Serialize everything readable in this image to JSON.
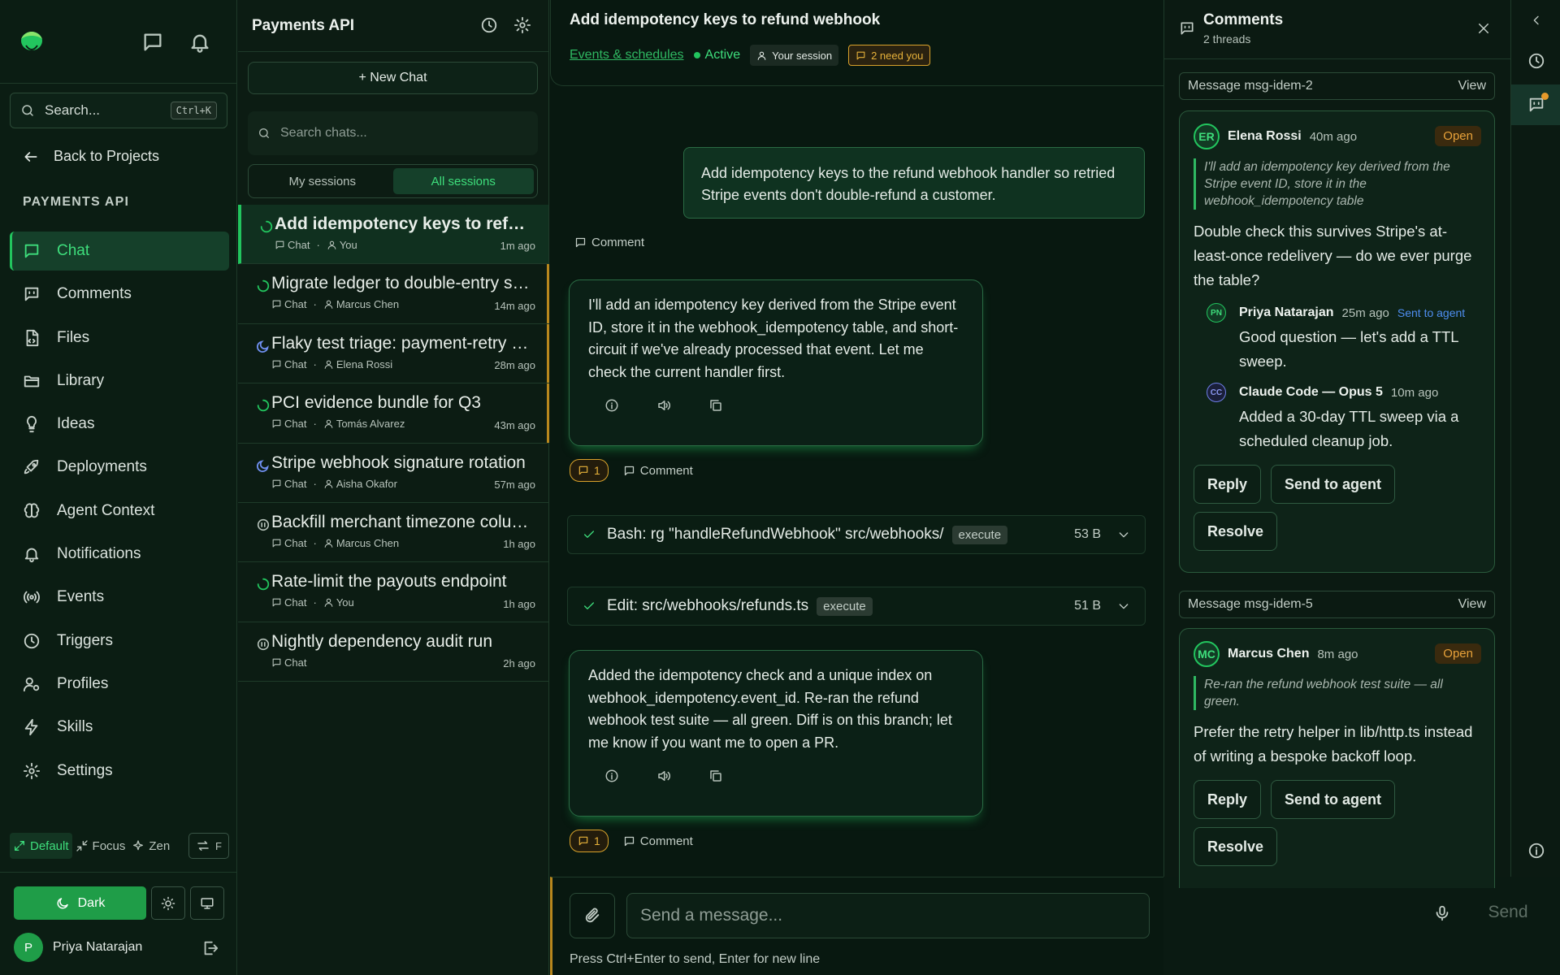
{
  "nav": {
    "search_placeholder": "Search...",
    "search_shortcut": "Ctrl+K",
    "back_label": "Back to Projects",
    "project_heading": "PAYMENTS API",
    "items": [
      {
        "label": "Chat",
        "icon": "chat-icon"
      },
      {
        "label": "Comments",
        "icon": "comments-icon"
      },
      {
        "label": "Files",
        "icon": "file-icon"
      },
      {
        "label": "Library",
        "icon": "folder-icon"
      },
      {
        "label": "Ideas",
        "icon": "lightbulb-icon"
      },
      {
        "label": "Deployments",
        "icon": "rocket-icon"
      },
      {
        "label": "Agent Context",
        "icon": "brain-icon"
      },
      {
        "label": "Notifications",
        "icon": "bell-icon"
      },
      {
        "label": "Events",
        "icon": "broadcast-icon"
      },
      {
        "label": "Triggers",
        "icon": "clock-icon"
      },
      {
        "label": "Profiles",
        "icon": "user-gear-icon"
      },
      {
        "label": "Skills",
        "icon": "lightning-icon"
      },
      {
        "label": "Settings",
        "icon": "gear-icon"
      }
    ],
    "modes": {
      "default": "Default",
      "focus": "Focus",
      "zen": "Zen",
      "f": "F"
    },
    "theme_dark": "Dark",
    "user_initial": "P",
    "user_name": "Priya Natarajan",
    "accent": "#22c55e"
  },
  "sessions": {
    "title": "Payments API",
    "new_chat": "+ New Chat",
    "search_placeholder": "Search chats...",
    "tabs": {
      "mine": "My sessions",
      "all": "All sessions"
    },
    "items": [
      {
        "title": "Add idempotency keys to refund webhook",
        "type": "Chat",
        "owner": "You",
        "ago": "1m ago",
        "status": "running"
      },
      {
        "title": "Migrate ledger to double-entry schema",
        "type": "Chat",
        "owner": "Marcus Chen",
        "ago": "14m ago",
        "status": "running"
      },
      {
        "title": "Flaky test triage: payment-retry suite",
        "type": "Chat",
        "owner": "Elena Rossi",
        "ago": "28m ago",
        "status": "sleeping"
      },
      {
        "title": "PCI evidence bundle for Q3",
        "type": "Chat",
        "owner": "Tomás Alvarez",
        "ago": "43m ago",
        "status": "running"
      },
      {
        "title": "Stripe webhook signature rotation",
        "type": "Chat",
        "owner": "Aisha Okafor",
        "ago": "57m ago",
        "status": "sleeping"
      },
      {
        "title": "Backfill merchant timezone column",
        "type": "Chat",
        "owner": "Marcus Chen",
        "ago": "1h ago",
        "status": "paused"
      },
      {
        "title": "Rate-limit the payouts endpoint",
        "type": "Chat",
        "owner": "You",
        "ago": "1h ago",
        "status": "running"
      },
      {
        "title": "Nightly dependency audit run",
        "type": "Chat",
        "owner": "",
        "ago": "2h ago",
        "status": "paused"
      }
    ]
  },
  "chat": {
    "title": "Add idempotency keys to refund webhook",
    "link": "Events & schedules",
    "status": "Active",
    "session_pill": "Your session",
    "need_pill": "2 need you",
    "user_message": "Add idempotency keys to the refund webhook handler so retried Stripe events don't double-refund a customer.",
    "comment_label": "Comment",
    "assistant_1": "I'll add an idempotency key derived from the Stripe event ID, store it in the webhook_idempotency table, and short-circuit if we've already processed that event. Let me check the current handler first.",
    "badge_1": "1",
    "tool_1": {
      "label": "Bash: rg \"handleRefundWebhook\" src/webhooks/",
      "tag": "execute",
      "size": "53 B"
    },
    "tool_2": {
      "label": "Edit: src/webhooks/refunds.ts",
      "tag": "execute",
      "size": "51 B"
    },
    "assistant_2": "Added the idempotency check and a unique index on webhook_idempotency.event_id. Re-ran the refund webhook test suite — all green. Diff is on this branch; let me know if you want me to open a PR.",
    "badge_2": "1",
    "composer_placeholder": "Send a message...",
    "hint": "Press Ctrl+Enter to send, Enter for new line",
    "send": "Send"
  },
  "comments": {
    "title": "Comments",
    "subtitle": "2 threads",
    "threads": [
      {
        "ref": "Message msg-idem-2",
        "view": "View",
        "initials": "ER",
        "author": "Elena Rossi",
        "time": "40m ago",
        "status": "Open",
        "quote": "I'll add an idempotency key derived from the Stripe event ID, store it in the webhook_idempotency table",
        "body": "Double check this survives Stripe's at-least-once redelivery — do we ever purge the table?",
        "replies": [
          {
            "initials": "PN",
            "author": "Priya Natarajan",
            "time": "25m ago",
            "tag": "Sent to agent",
            "body": "Good question — let's add a TTL sweep."
          },
          {
            "initials": "CC",
            "author": "Claude Code — Opus 5",
            "time": "10m ago",
            "tag": "",
            "body": "Added a 30-day TTL sweep via a scheduled cleanup job."
          }
        ],
        "btn_reply": "Reply",
        "btn_send": "Send to agent",
        "btn_resolve": "Resolve"
      },
      {
        "ref": "Message msg-idem-5",
        "view": "View",
        "initials": "MC",
        "author": "Marcus Chen",
        "time": "8m ago",
        "status": "Open",
        "quote": "Re-ran the refund webhook test suite — all green.",
        "body": "Prefer the retry helper in lib/http.ts instead of writing a bespoke backoff loop.",
        "btn_reply": "Reply",
        "btn_send": "Send to agent",
        "btn_resolve": "Resolve"
      }
    ]
  }
}
